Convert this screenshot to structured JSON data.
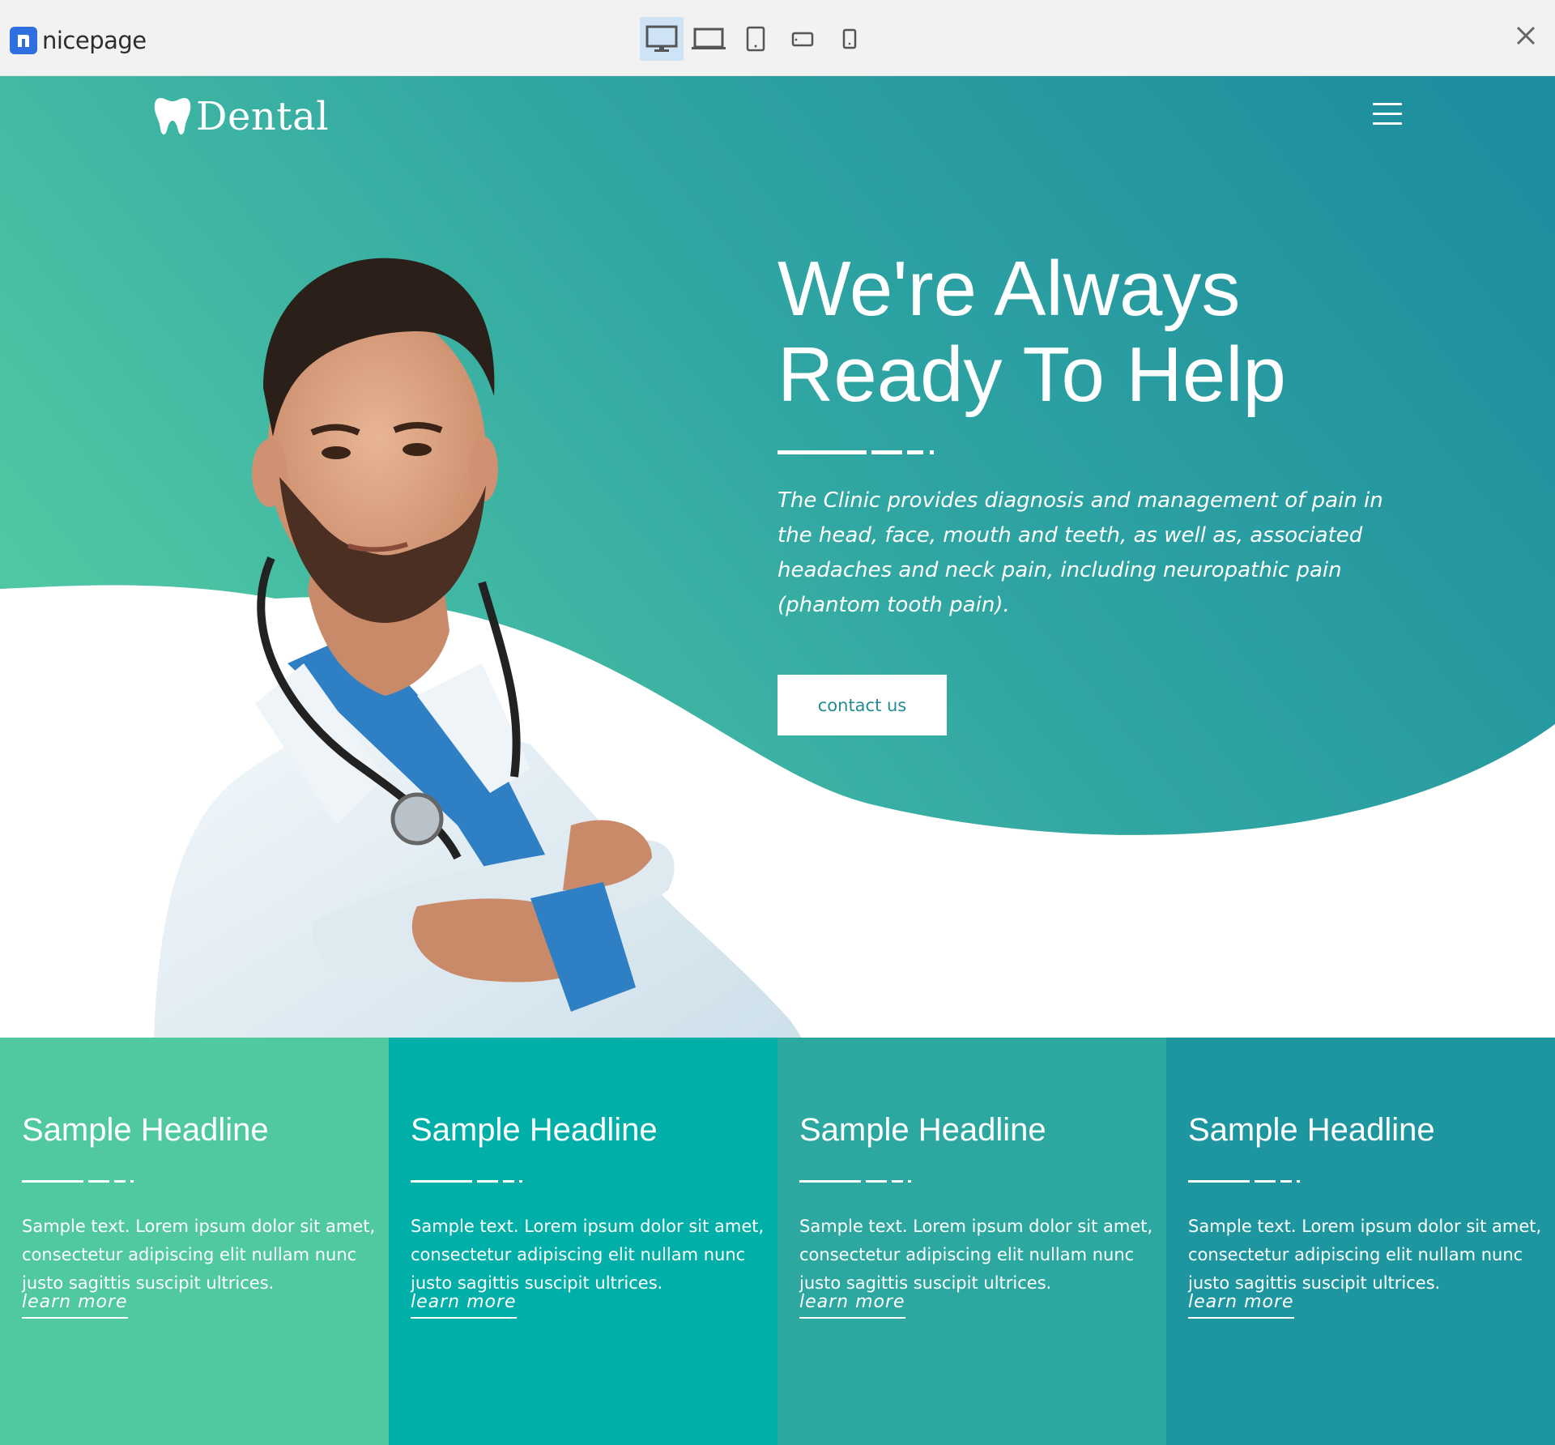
{
  "builder": {
    "brand_name": "nicepage",
    "devices": [
      {
        "name": "desktop",
        "active": true
      },
      {
        "name": "laptop",
        "active": false
      },
      {
        "name": "tablet",
        "active": false
      },
      {
        "name": "phone-landscape",
        "active": false
      },
      {
        "name": "phone-portrait",
        "active": false
      }
    ],
    "close_icon": "close-icon"
  },
  "site": {
    "logo_text": "Dental",
    "logo_icon": "tooth-icon",
    "menu_icon": "hamburger-menu-icon"
  },
  "hero": {
    "title_line1": "We're Always",
    "title_line2": "Ready To Help",
    "text": "The Clinic provides diagnosis and management of pain in the head, face, mouth and teeth, as well as, associated headaches and neck pain, including neuropathic pain (phantom tooth pain).",
    "button_label": "contact us"
  },
  "features": [
    {
      "headline": "Sample Headline",
      "text": "Sample text. Lorem ipsum dolor sit amet, consectetur adipiscing elit nullam nunc justo sagittis suscipit ultrices.",
      "link": "learn more",
      "color": "#50c8a0"
    },
    {
      "headline": "Sample Headline",
      "text": "Sample text. Lorem ipsum dolor sit amet, consectetur adipiscing elit nullam nunc justo sagittis suscipit ultrices.",
      "link": "learn more",
      "color": "#00b0a8"
    },
    {
      "headline": "Sample Headline",
      "text": "Sample text. Lorem ipsum dolor sit amet, consectetur adipiscing elit nullam nunc justo sagittis suscipit ultrices.",
      "link": "learn more",
      "color": "#2da8a0"
    },
    {
      "headline": "Sample Headline",
      "text": "Sample text. Lorem ipsum dolor sit amet, consectetur adipiscing elit nullam nunc justo sagittis suscipit ultrices.",
      "link": "learn more",
      "color": "#1e96a0"
    }
  ],
  "colors": {
    "gradient_start": "#4fc7a3",
    "gradient_end": "#1e8f9e",
    "button_text": "#238c94",
    "device_active_bg": "#cfe3f7"
  }
}
